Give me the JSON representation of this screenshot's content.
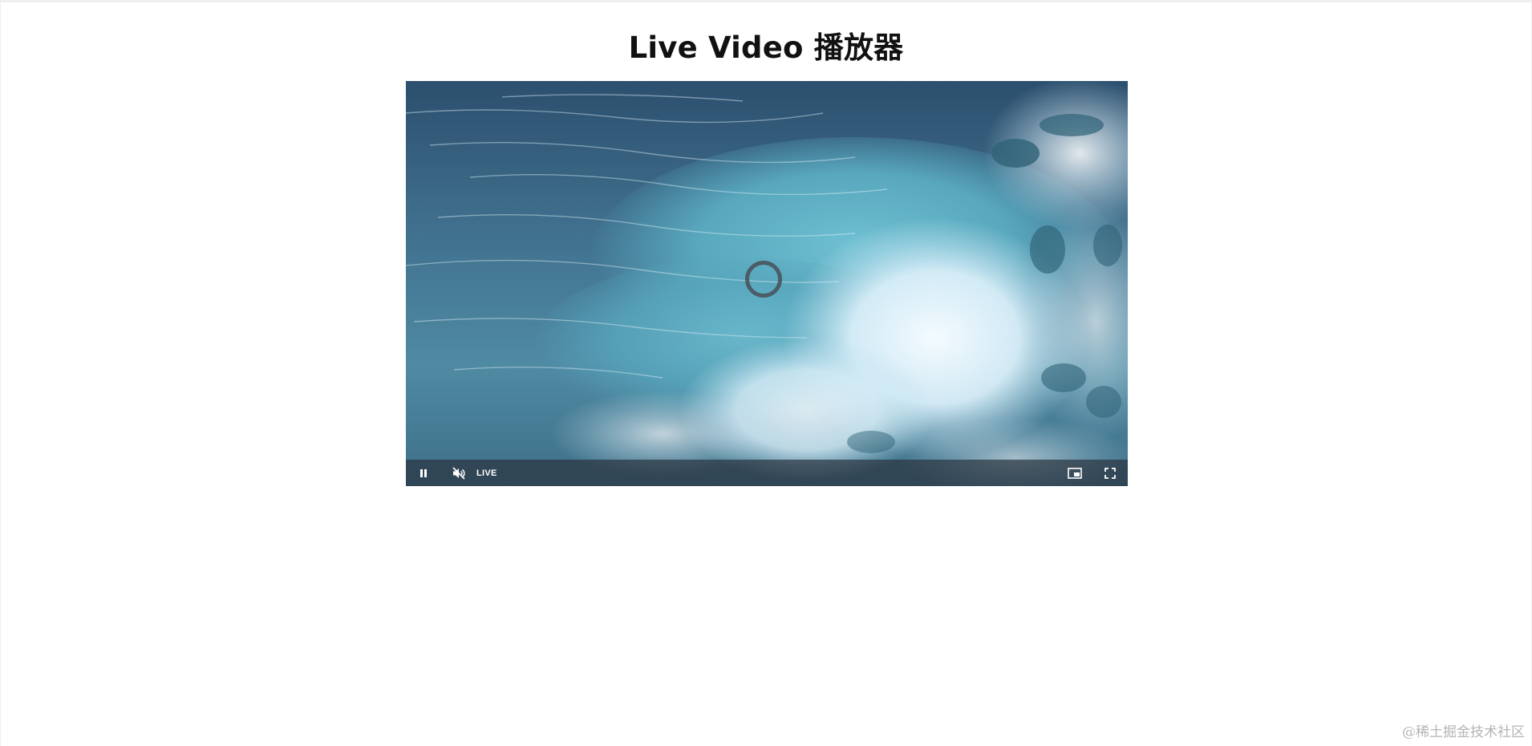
{
  "page": {
    "title": "Live Video 播放器"
  },
  "player": {
    "media": "ocean-wave-video-frame",
    "state": "loading",
    "controls": {
      "pause_icon": "pause-icon",
      "mute_icon": "volume-muted-icon",
      "live_label": "LIVE",
      "pip_icon": "picture-in-picture-icon",
      "fullscreen_icon": "fullscreen-icon"
    },
    "colors": {
      "control_bar": "#2b333f",
      "control_icon": "#ffffff"
    }
  },
  "watermark": {
    "text": "@稀土掘金技术社区"
  }
}
